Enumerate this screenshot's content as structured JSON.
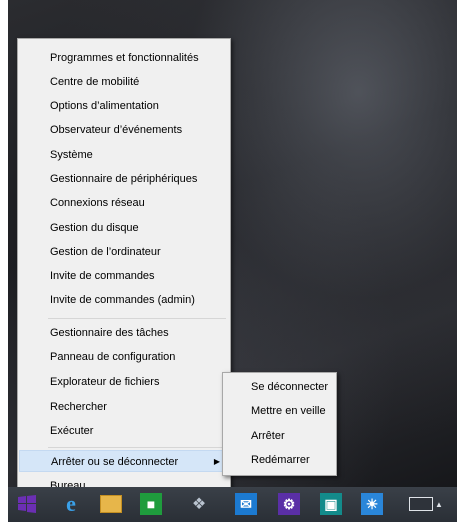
{
  "context_menu": {
    "group1": [
      "Programmes et fonctionnalités",
      "Centre de mobilité",
      "Options d’alimentation",
      "Observateur d’événements",
      "Système",
      "Gestionnaire de périphériques",
      "Connexions réseau",
      "Gestion du disque",
      "Gestion de l’ordinateur",
      "Invite de commandes",
      "Invite de commandes (admin)"
    ],
    "group2": [
      "Gestionnaire des tâches",
      "Panneau de configuration",
      "Explorateur de fichiers",
      "Rechercher",
      "Exécuter"
    ],
    "shutdown_item": "Arrêter ou se déconnecter",
    "desktop_item": "Bureau"
  },
  "submenu": {
    "items": [
      "Se déconnecter",
      "Mettre en veille",
      "Arrêter",
      "Redémarrer"
    ]
  },
  "taskbar": {
    "icons": [
      "start-icon",
      "internet-explorer-icon",
      "file-explorer-icon",
      "store-icon",
      "satellite-icon",
      "mail-icon",
      "settings-icon",
      "photos-icon",
      "weather-icon",
      "keyboard-icon"
    ],
    "tray_arrow": "▲"
  },
  "colors": {
    "menu_bg": "#f0f0f0",
    "highlight": "#d5e6f8",
    "taskbar": "#2e333a"
  }
}
